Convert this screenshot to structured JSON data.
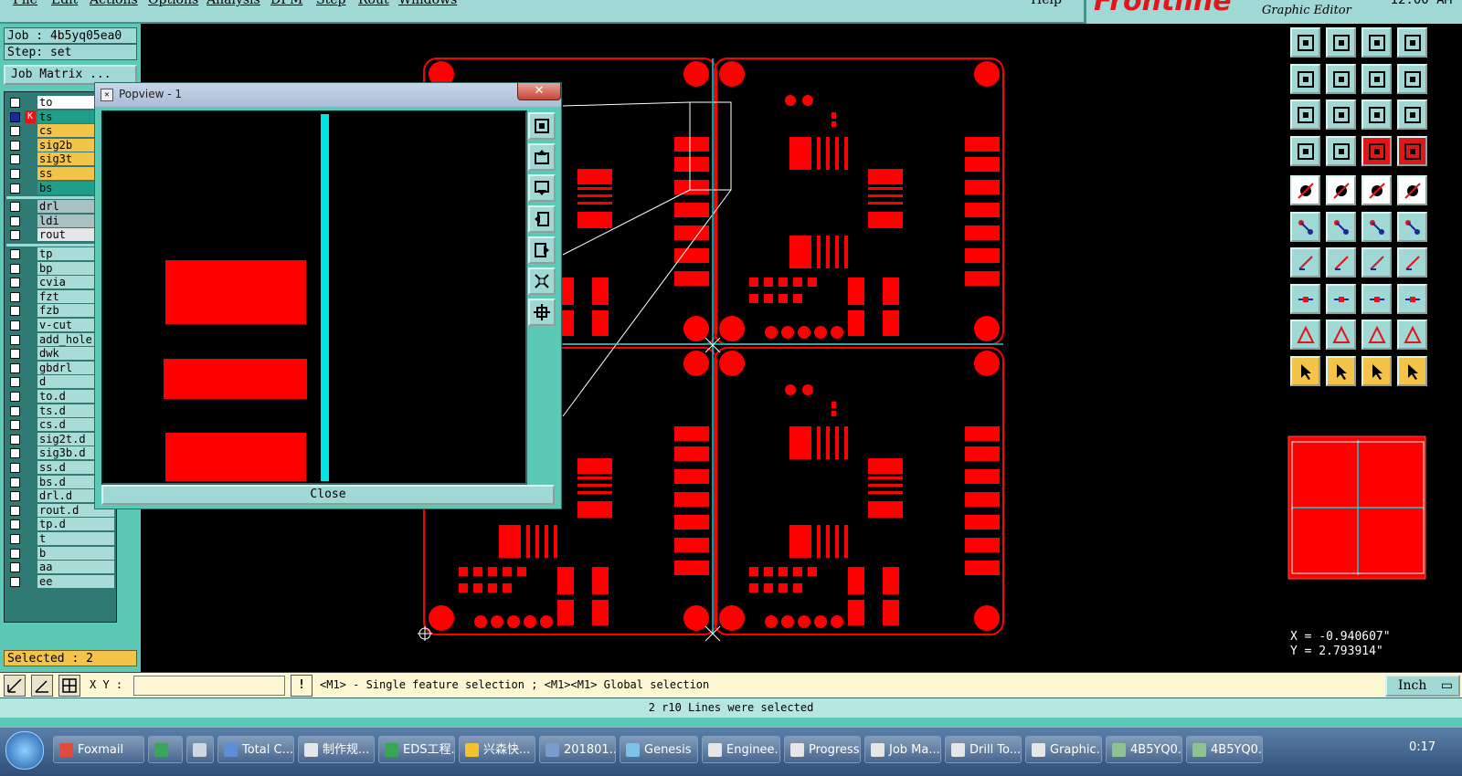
{
  "menu": {
    "items": [
      "File",
      "Edit",
      "Actions",
      "Options",
      "Analysis",
      "DFM",
      "Step",
      "Rout",
      "Windows"
    ],
    "help": "Help"
  },
  "brand": {
    "logo": "Frontline",
    "subtitle": "Graphic Editor",
    "clock": "12:00 AM"
  },
  "job": {
    "job_label": "Job : 4b5yq05ea0",
    "step_label": "Step: set",
    "matrix_button": "Job Matrix ..."
  },
  "layers": {
    "group1": [
      {
        "name": "to",
        "color": "#ffffff"
      },
      {
        "name": "ts",
        "color": "#1f9e8a",
        "work": true
      },
      {
        "name": "cs",
        "color": "#f4c34a"
      },
      {
        "name": "sig2b",
        "color": "#f4c34a"
      },
      {
        "name": "sig3t",
        "color": "#f4c34a"
      },
      {
        "name": "ss",
        "color": "#f4c34a"
      },
      {
        "name": "bs",
        "color": "#1f9e8a"
      }
    ],
    "group2": [
      {
        "name": "drl",
        "color": "#a9c1c2"
      },
      {
        "name": "ldi",
        "color": "#a9c1c2"
      },
      {
        "name": "rout",
        "color": "#e6e6e6"
      }
    ],
    "group3": [
      {
        "name": "tp"
      },
      {
        "name": "bp"
      },
      {
        "name": "cvia"
      },
      {
        "name": "fzt"
      },
      {
        "name": "fzb"
      },
      {
        "name": "v-cut"
      },
      {
        "name": "add_hole"
      },
      {
        "name": "dwk"
      },
      {
        "name": "gbdrl"
      },
      {
        "name": "d"
      },
      {
        "name": "to.d"
      },
      {
        "name": "ts.d"
      },
      {
        "name": "cs.d"
      },
      {
        "name": "sig2t.d"
      },
      {
        "name": "sig3b.d"
      },
      {
        "name": "ss.d"
      },
      {
        "name": "bs.d"
      },
      {
        "name": "drl.d"
      },
      {
        "name": "rout.d"
      },
      {
        "name": "tp.d"
      },
      {
        "name": "t"
      },
      {
        "name": "b"
      },
      {
        "name": "aa"
      },
      {
        "name": "ee"
      }
    ],
    "work_marker": "K"
  },
  "selected_count": "Selected : 2",
  "popview": {
    "title": "Popview - 1",
    "close_x": "✕",
    "close_button": "Close"
  },
  "right_toolbar": {
    "icons": [
      "zoom-home-icon",
      "zoom-page-icon",
      "home-icon",
      "zoom-next-icon",
      "pan-left-icon",
      "pan-right-icon",
      "undo-zoom-icon",
      "redo-zoom-icon",
      "fit-icon",
      "fit-window-icon",
      "scale-1-2-icon",
      "help-icon",
      "settings-icon",
      "snap-icon",
      "graphic-control-icon",
      "layer-control-icon",
      "add-pad-icon",
      "add-surface-icon",
      "measure-icon",
      "hole-icon",
      "add-line-icon",
      "delete-icon",
      "move-icon",
      "connect-icon",
      "edit-line-icon",
      "edit-slash-icon",
      "rotate-icon",
      "mirror-icon",
      "copy-icon",
      "cut-line-icon",
      "resize-icon",
      "shape-icon",
      "triangle-a-icon",
      "triangle-b-icon",
      "triangle-c-icon",
      "triangle-d-icon",
      "select-arrow-icon",
      "select-arrow-box-icon",
      "select-arrow-circle-icon",
      "route-icon"
    ]
  },
  "coords": {
    "x": "X = -0.940607\"",
    "y": "Y = 2.793914\""
  },
  "command": {
    "xy_label": "X Y :",
    "xy_value": "",
    "excl": "!",
    "hint": "<M1> - Single feature selection ; <M1><M1> Global selection",
    "units": "Inch"
  },
  "status": "2 r10 Lines were selected",
  "taskbar": {
    "items": [
      {
        "label": "Foxmail",
        "color": "#e24a3b"
      },
      {
        "label": "",
        "color": "#3aa658"
      },
      {
        "label": "",
        "color": "#cfd6df"
      },
      {
        "label": "Total C...",
        "color": "#5d8fd8"
      },
      {
        "label": "制作规...",
        "color": "#e6e6e6"
      },
      {
        "label": "EDS工程...",
        "color": "#36a852"
      },
      {
        "label": "兴森快...",
        "color": "#f2c230"
      },
      {
        "label": "201801...",
        "color": "#7b9ccc"
      },
      {
        "label": "Genesis",
        "color": "#7cc2e8"
      },
      {
        "label": "Enginee...",
        "color": "#e6e6e6"
      },
      {
        "label": "Progress",
        "color": "#e6e6e6"
      },
      {
        "label": "Job Ma...",
        "color": "#e6e6e6"
      },
      {
        "label": "Drill To...",
        "color": "#e6e6e6"
      },
      {
        "label": "Graphic...",
        "color": "#e6e6e6"
      },
      {
        "label": "4B5YQ0...",
        "color": "#8fc28f"
      },
      {
        "label": "4B5YQ0...",
        "color": "#8fc28f"
      }
    ],
    "clock": "0:17"
  },
  "colors": {
    "accent": "#5cc8b6",
    "feature": "#ff0000",
    "highlight": "#00e5e5"
  }
}
